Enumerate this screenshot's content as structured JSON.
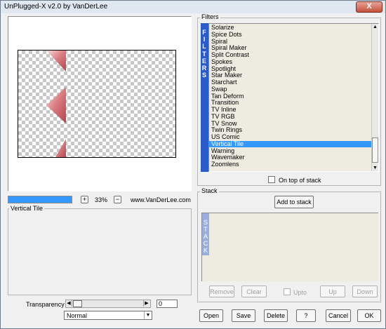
{
  "window": {
    "title": "UnPlugged-X v2.0 by VanDerLee",
    "close_glyph": "X"
  },
  "preview": {
    "zoom": "33%",
    "zoom_in": "+",
    "zoom_out": "−",
    "website": "www.VanDerLee.com",
    "progress_percent": 100
  },
  "filter_info": {
    "label": "Vertical Tile"
  },
  "transparency": {
    "label": "Transparency",
    "value": "0"
  },
  "blend": {
    "selected": "Normal"
  },
  "filters": {
    "label": "Filters",
    "sidebar_letters": [
      "F",
      "I",
      "L",
      "T",
      "E",
      "R",
      "S"
    ],
    "items": [
      "Solarize",
      "Spice Dots",
      "Spiral",
      "Spiral Maker",
      "Split Contrast",
      "Spokes",
      "Spotlight",
      "Star Maker",
      "Starchart",
      "Swap",
      "Tan Deform",
      "Transition",
      "TV Inline",
      "TV RGB",
      "TV Snow",
      "Twin Rings",
      "US Comic",
      "Vertical Tile",
      "Warning",
      "Wavemaker",
      "Zoomlens"
    ],
    "selected_index": 17,
    "on_top_label": "On top of stack"
  },
  "stack": {
    "label": "Stack",
    "add_label": "Add to stack",
    "sidebar_letters": [
      "S",
      "T",
      "A",
      "C",
      "K"
    ],
    "remove_label": "Remove",
    "clear_label": "Clear",
    "upto_label": "Upto",
    "up_label": "Up",
    "down_label": "Down"
  },
  "footer": {
    "open_label": "Open",
    "save_label": "Save",
    "delete_label": "Delete",
    "help_label": "?",
    "cancel_label": "Cancel",
    "ok_label": "OK"
  }
}
